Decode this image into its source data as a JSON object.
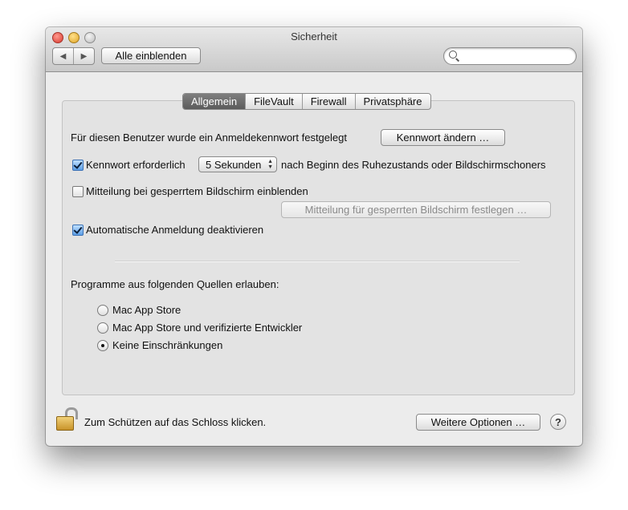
{
  "window": {
    "title": "Sicherheit"
  },
  "toolbar": {
    "back_glyph": "◀",
    "forward_glyph": "▶",
    "show_all_label": "Alle einblenden",
    "search_placeholder": ""
  },
  "tabs": [
    {
      "label": "Allgemein",
      "selected": true
    },
    {
      "label": "FileVault",
      "selected": false
    },
    {
      "label": "Firewall",
      "selected": false
    },
    {
      "label": "Privatsphäre",
      "selected": false
    }
  ],
  "general": {
    "password_set_text": "Für diesen Benutzer wurde ein Anmeldekennwort festgelegt",
    "change_password_label": "Kennwort ändern …",
    "require_password": {
      "label": "Kennwort erforderlich",
      "checked": true
    },
    "delay_value": "5 Sekunden",
    "delay_suffix": "nach Beginn des Ruhezustands oder Bildschirmschoners",
    "show_message": {
      "label": "Mitteilung bei gesperrtem Bildschirm einblenden",
      "checked": false
    },
    "set_message_label": "Mitteilung für gesperrten Bildschirm festlegen …",
    "disable_autologin": {
      "label": "Automatische Anmeldung deaktivieren",
      "checked": true
    },
    "sources_heading": "Programme aus folgenden Quellen erlauben:",
    "sources": [
      {
        "label": "Mac App Store",
        "selected": false
      },
      {
        "label": "Mac App Store und verifizierte Entwickler",
        "selected": false
      },
      {
        "label": "Keine Einschränkungen",
        "selected": true
      }
    ]
  },
  "footer": {
    "lock_text": "Zum Schützen auf das Schloss klicken.",
    "advanced_label": "Weitere Optionen …",
    "help_glyph": "?"
  },
  "colors": {
    "selected_tab": "#6a6a6a",
    "checkbox_checked": "#5b9ee6"
  }
}
